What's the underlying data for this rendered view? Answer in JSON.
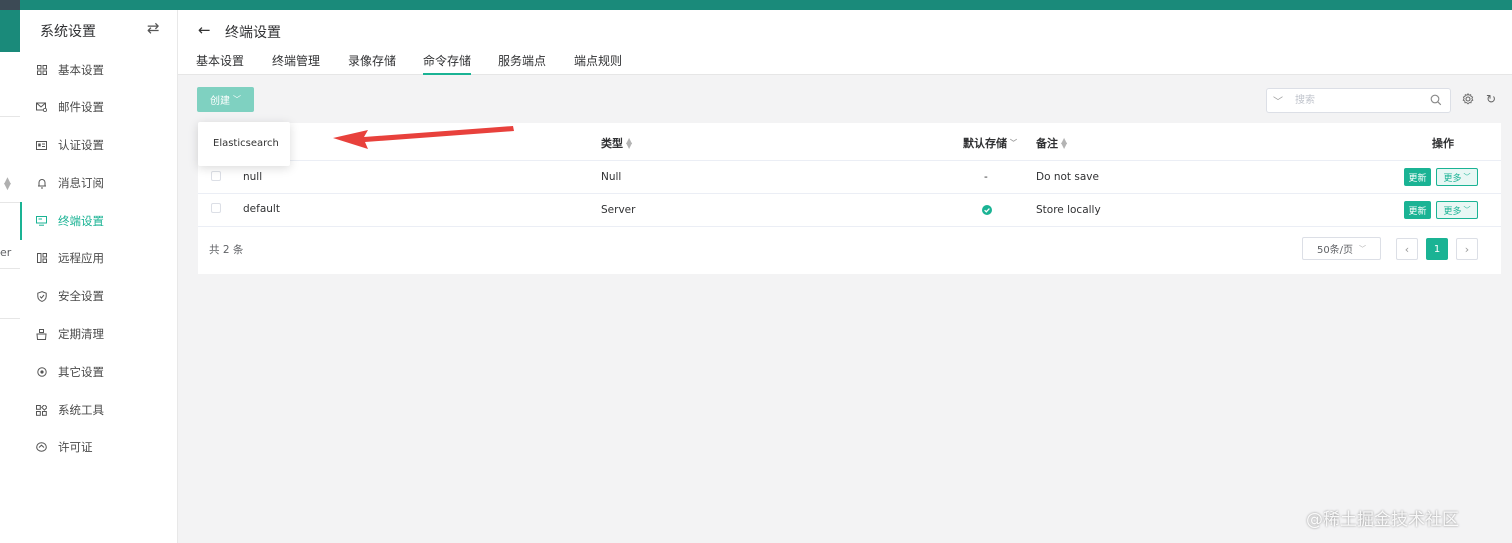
{
  "background_strip": {
    "fragment": "er"
  },
  "sidebar": {
    "title": "系统设置",
    "items": [
      {
        "label": "基本设置",
        "icon": "grid-icon"
      },
      {
        "label": "邮件设置",
        "icon": "mail-icon"
      },
      {
        "label": "认证设置",
        "icon": "id-card-icon"
      },
      {
        "label": "消息订阅",
        "icon": "bell-icon"
      },
      {
        "label": "终端设置",
        "icon": "monitor-icon",
        "active": true
      },
      {
        "label": "远程应用",
        "icon": "apps-icon"
      },
      {
        "label": "安全设置",
        "icon": "shield-icon"
      },
      {
        "label": "定期清理",
        "icon": "broom-icon"
      },
      {
        "label": "其它设置",
        "icon": "circle-icon"
      },
      {
        "label": "系统工具",
        "icon": "tools-icon"
      },
      {
        "label": "许可证",
        "icon": "license-icon"
      }
    ]
  },
  "header": {
    "title": "终端设置",
    "tabs": [
      {
        "label": "基本设置"
      },
      {
        "label": "终端管理"
      },
      {
        "label": "录像存储"
      },
      {
        "label": "命令存储",
        "active": true
      },
      {
        "label": "服务端点"
      },
      {
        "label": "端点规则"
      }
    ]
  },
  "toolbar": {
    "create_label": "创建",
    "search_placeholder": "搜索"
  },
  "dropdown": {
    "item": "Elasticsearch"
  },
  "table": {
    "columns": {
      "type": "类型",
      "default": "默认存储",
      "comment": "备注",
      "actions": "操作"
    },
    "rows": [
      {
        "name": "null",
        "type": "Null",
        "default": "-",
        "comment": "Do not save"
      },
      {
        "name": "default",
        "type": "Server",
        "default": "check",
        "comment": "Store locally"
      }
    ],
    "update_label": "更新",
    "more_label": "更多"
  },
  "pagination": {
    "total_text": "共 2 条",
    "page_size": "50条/页",
    "current_page": "1"
  },
  "watermark": "@稀土掘金技术社区",
  "colors": {
    "accent": "#1ab394",
    "topbar": "#1a8a7a",
    "annotation_arrow": "#e8413c"
  }
}
